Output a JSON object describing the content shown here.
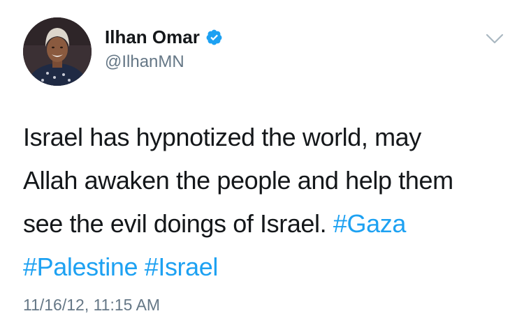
{
  "author": {
    "display_name": "Ilhan Omar",
    "handle": "@IlhanMN",
    "verified": true
  },
  "tweet": {
    "line1": "Israel has hypnotized the world, may",
    "line2": "Allah awaken the people and help them",
    "line3_text": "see the evil doings of Israel.",
    "hashtag_gaza": "#Gaza",
    "hashtag_palestine": "#Palestine",
    "hashtag_israel": "#Israel"
  },
  "timestamp": "11/16/12, 11:15 AM",
  "colors": {
    "accent": "#1da1f2",
    "secondary_text": "#657786",
    "primary_text": "#14171a"
  },
  "icons": {
    "verified": "verified-badge-icon",
    "menu": "chevron-down-icon"
  }
}
